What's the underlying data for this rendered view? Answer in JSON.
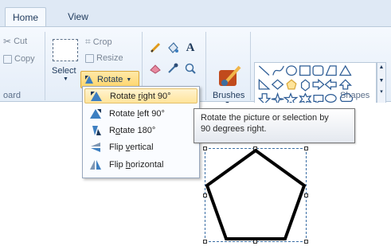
{
  "tabs": [
    {
      "label": "Home",
      "active": true
    },
    {
      "label": "View",
      "active": false
    }
  ],
  "clipboard": {
    "cut_label": "Cut",
    "copy_label": "Copy",
    "group_label": "oard"
  },
  "image": {
    "select_label": "Select",
    "crop_label": "Crop",
    "resize_label": "Resize",
    "rotate_label": "Rotate"
  },
  "tools": {
    "items": [
      "pencil-icon",
      "fill-icon",
      "text-icon",
      "eraser-icon",
      "color-picker-icon",
      "magnifier-icon"
    ],
    "text_glyph": "A"
  },
  "brushes": {
    "label": "Brushes"
  },
  "shapes": {
    "group_label": "Shapes"
  },
  "rotate_menu": {
    "items": [
      {
        "label": "Rotate right 90°",
        "mnemonic_index": 7,
        "icon": "rotate-right-icon",
        "highlighted": true
      },
      {
        "label": "Rotate left 90°",
        "mnemonic_index": 7,
        "icon": "rotate-left-icon",
        "highlighted": false
      },
      {
        "label": "Rotate 180°",
        "mnemonic_index": 1,
        "icon": "rotate-180-icon",
        "highlighted": false
      },
      {
        "label": "Flip vertical",
        "mnemonic_index": 5,
        "icon": "flip-vertical-icon",
        "highlighted": false
      },
      {
        "label": "Flip horizontal",
        "mnemonic_index": 5,
        "icon": "flip-horizontal-icon",
        "highlighted": false
      }
    ]
  },
  "tooltip": {
    "text_line1": "Rotate the picture or selection by",
    "text_line2": "90 degrees right."
  },
  "colors": {
    "accent_hover": "#ffe49b",
    "ribbon_bg": "#e4edf8",
    "selection_border": "#3a6ea5"
  }
}
